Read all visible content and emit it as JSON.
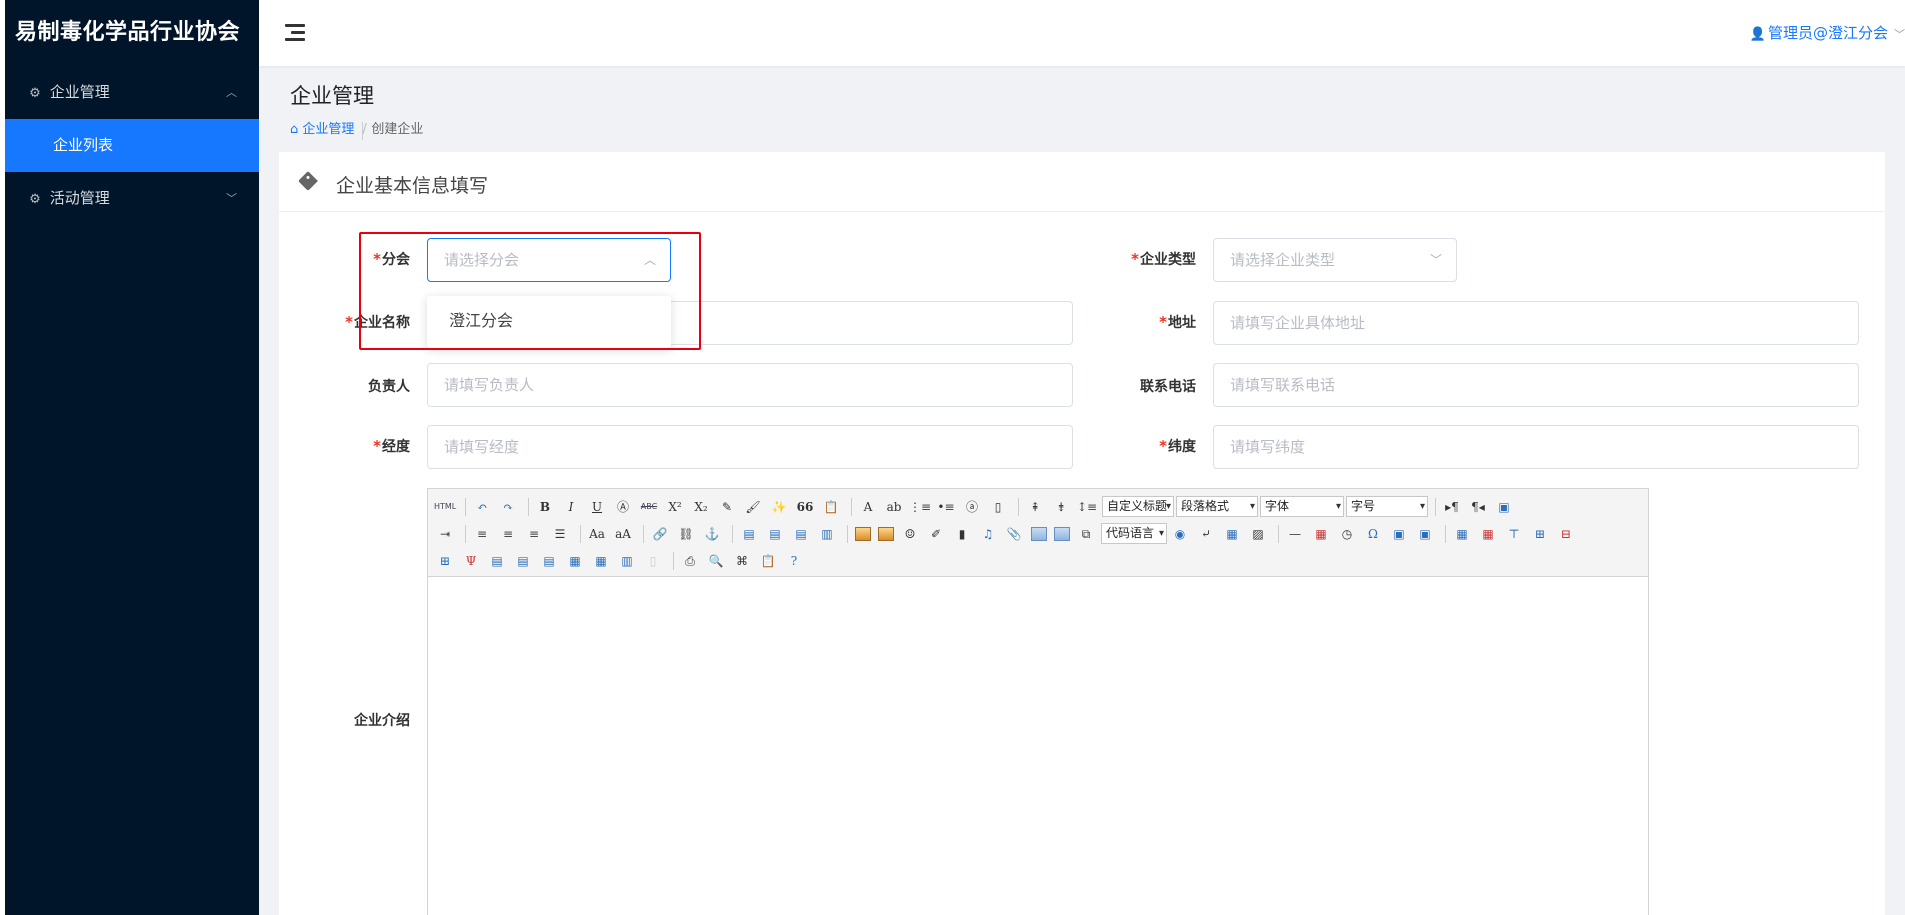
{
  "app": {
    "title": "易制毒化学品行业协会"
  },
  "sidebar": {
    "groups": [
      {
        "label": "企业管理",
        "icon": "gear-icon",
        "expanded": true,
        "items": [
          {
            "label": "企业列表",
            "active": true
          }
        ]
      },
      {
        "label": "活动管理",
        "icon": "gear-icon",
        "expanded": false,
        "items": []
      }
    ]
  },
  "header": {
    "user": "管理员@澄江分会"
  },
  "page": {
    "title": "企业管理",
    "breadcrumb": {
      "home": "企业管理",
      "current": "创建企业"
    }
  },
  "card": {
    "title": "企业基本信息填写"
  },
  "form": {
    "branch": {
      "label": "分会",
      "required": true,
      "placeholder": "请选择分会",
      "options": [
        "澄江分会"
      ]
    },
    "company_type": {
      "label": "企业类型",
      "required": true,
      "placeholder": "请选择企业类型"
    },
    "company_name": {
      "label": "企业名称",
      "required": true,
      "placeholder": ""
    },
    "address": {
      "label": "地址",
      "required": true,
      "placeholder": "请填写企业具体地址"
    },
    "owner": {
      "label": "负责人",
      "required": false,
      "placeholder": "请填写负责人"
    },
    "phone": {
      "label": "联系电话",
      "required": false,
      "placeholder": "请填写联系电话"
    },
    "longitude": {
      "label": "经度",
      "required": true,
      "placeholder": "请填写经度"
    },
    "latitude": {
      "label": "纬度",
      "required": true,
      "placeholder": "请填写纬度"
    },
    "intro": {
      "label": "企业介绍"
    }
  },
  "editor": {
    "selects": {
      "custom_title": "自定义标题",
      "paragraph": "段落格式",
      "font": "字体",
      "size": "字号",
      "code": "代码语言"
    },
    "html_label": "HTML",
    "bold": "B",
    "italic": "I",
    "underline": "U",
    "abc": "ABC",
    "quote": "66",
    "omega": "Ω",
    "dash": "—",
    "font_a": "A",
    "sup": "X²",
    "sub": "X₂"
  },
  "colors": {
    "sidebar_bg": "#001529",
    "accent": "#1677ff",
    "required": "#e32",
    "highlight": "#e60012"
  }
}
